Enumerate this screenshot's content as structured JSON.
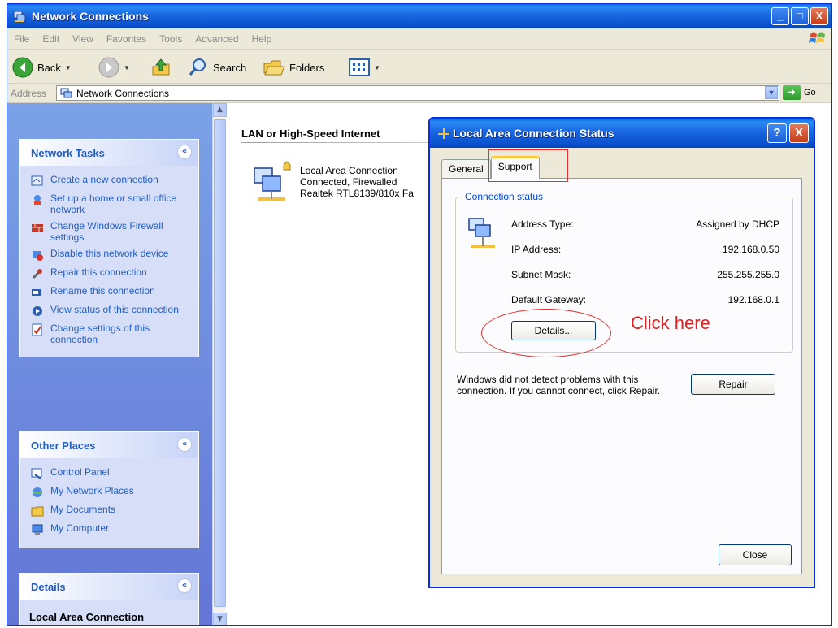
{
  "window": {
    "title": "Network Connections",
    "controls": {
      "minimize": "_",
      "maximize": "□",
      "close": "X"
    }
  },
  "menu": [
    "File",
    "Edit",
    "View",
    "Favorites",
    "Tools",
    "Advanced",
    "Help"
  ],
  "toolbar": {
    "back_label": "Back",
    "search_label": "Search",
    "folders_label": "Folders"
  },
  "address": {
    "label": "Address",
    "value": "Network Connections",
    "go_label": "Go"
  },
  "network_tasks": {
    "title": "Network Tasks",
    "collapse": "«",
    "items": [
      {
        "label": "Create a new connection",
        "icon": "new-connection-icon"
      },
      {
        "label": "Set up a home or small office network",
        "icon": "home-network-icon"
      },
      {
        "label": "Change Windows Firewall settings",
        "icon": "firewall-icon"
      },
      {
        "label": "Disable this network device",
        "icon": "disable-device-icon"
      },
      {
        "label": "Repair this connection",
        "icon": "repair-icon"
      },
      {
        "label": "Rename this connection",
        "icon": "rename-icon"
      },
      {
        "label": "View status of this connection",
        "icon": "view-status-icon"
      },
      {
        "label": "Change settings of this connection",
        "icon": "settings-icon"
      }
    ]
  },
  "other_places": {
    "title": "Other Places",
    "collapse": "«",
    "items": [
      {
        "label": "Control Panel",
        "icon": "control-panel-icon"
      },
      {
        "label": "My Network Places",
        "icon": "network-places-icon"
      },
      {
        "label": "My Documents",
        "icon": "documents-icon"
      },
      {
        "label": "My Computer",
        "icon": "computer-icon"
      }
    ]
  },
  "details_panel": {
    "title": "Details",
    "collapse": "«",
    "body": "Local Area Connection"
  },
  "content": {
    "group_title": "LAN or High-Speed Internet",
    "connection": {
      "name": "Local Area Connection",
      "status": "Connected, Firewalled",
      "adapter": "Realtek RTL8139/810x Fa"
    }
  },
  "dialog": {
    "title": "Local Area Connection Status",
    "help": "?",
    "close": "X",
    "tabs": [
      "General",
      "Support"
    ],
    "active_tab": "Support",
    "group_title": "Connection status",
    "fields": [
      {
        "label": "Address Type:",
        "value": "Assigned by DHCP"
      },
      {
        "label": "IP Address:",
        "value": "192.168.0.50"
      },
      {
        "label": "Subnet Mask:",
        "value": "255.255.255.0"
      },
      {
        "label": "Default Gateway:",
        "value": "192.168.0.1"
      }
    ],
    "details_button": "Details...",
    "annotation": "Click here",
    "diagnostic_text": "Windows did not detect problems with this connection. If you cannot connect, click Repair.",
    "repair_button": "Repair",
    "close_button": "Close"
  }
}
